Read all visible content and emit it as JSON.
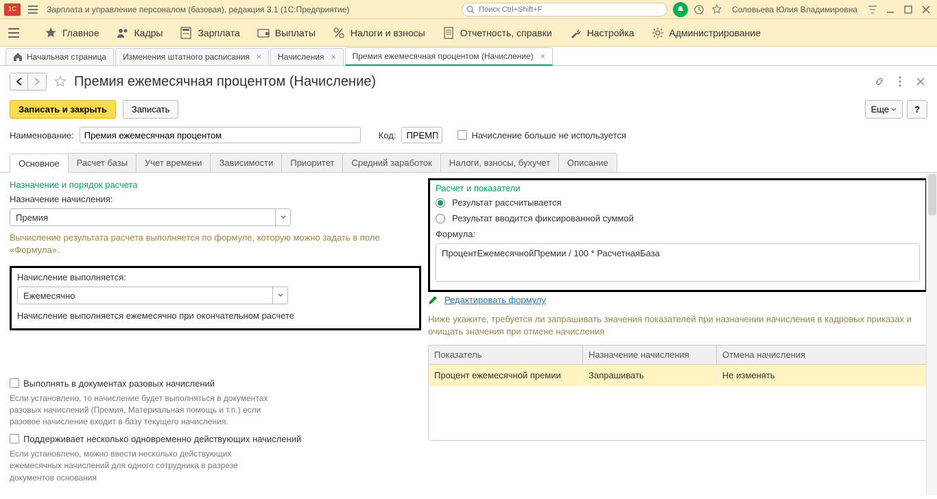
{
  "titlebar": {
    "app_title": "Зарплата и управление персоналом (базовая), редакция 3.1  (1С:Предприятие)",
    "search_placeholder": "Поиск Ctrl+Shift+F",
    "user": "Соловьева Юлия Владимировна"
  },
  "menu": {
    "main": "Главное",
    "hr": "Кадры",
    "salary": "Зарплата",
    "payments": "Выплаты",
    "taxes": "Налоги и взносы",
    "reports": "Отчетность, справки",
    "settings": "Настройка",
    "admin": "Администрирование"
  },
  "doc_tabs": {
    "start": "Начальная страница",
    "staff": "Изменения штатного расписания",
    "accruals": "Начисления",
    "current": "Премия ежемесячная процентом (Начисление)"
  },
  "page": {
    "title": "Премия ежемесячная процентом (Начисление)",
    "save_close": "Записать и закрыть",
    "save": "Записать",
    "more": "Еще",
    "help": "?"
  },
  "header_form": {
    "name_label": "Наименование:",
    "name_value": "Премия ежемесячная процентом",
    "code_label": "Код:",
    "code_value": "ПРЕМП",
    "not_used_label": "Начисление больше не используется"
  },
  "tabs": {
    "main": "Основное",
    "base": "Расчет базы",
    "time": "Учет времени",
    "deps": "Зависимости",
    "prio": "Приоритет",
    "avg": "Средний заработок",
    "tax": "Налоги, взносы, бухучет",
    "desc": "Описание"
  },
  "left": {
    "group1": "Назначение и порядок расчета",
    "assign_label": "Назначение начисления:",
    "assign_value": "Премия",
    "assign_hint": "Вычисление результата расчета выполняется по формуле, которую можно задать в поле «Формула».",
    "perform_label": "Начисление выполняется:",
    "perform_value": "Ежемесячно",
    "perform_hint": "Начисление выполняется ежемесячно при окончательном расчете",
    "cb1_label": "Выполнять в документах разовых начислений",
    "cb1_hint": "Если установлено, то начисление будет выполняться в документах разовых начислений (Премия, Материальная помощь и т.п.) если разовое начисление входит в базу текущего начисления.",
    "cb2_label": "Поддерживает несколько одновременно действующих начислений",
    "cb2_hint": "Если установлено, можно ввести несколько действующих ежемесячных начислений для одного сотрудника в разрезе документов основания"
  },
  "right": {
    "group": "Расчет и показатели",
    "radio1": "Результат рассчитывается",
    "radio2": "Результат вводится фиксированной суммой",
    "formula_label": "Формула:",
    "formula_value": "ПроцентЕжемесячнойПремии / 100 * РасчетнаяБаза",
    "edit_link": "Редактировать формулу",
    "hint": "Ниже укажите, требуется ли запрашивать значения показателей при назначении начисления в кадровых приказах и очищать значения при отмене начисления",
    "th1": "Показатель",
    "th2": "Назначение начисления",
    "th3": "Отмена начисления",
    "td1": "Процент ежемесячной премии",
    "td2": "Запрашивать",
    "td3": "Не изменять"
  }
}
